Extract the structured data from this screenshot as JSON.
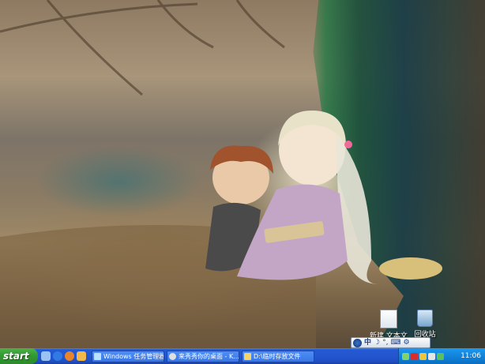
{
  "desktop": {
    "icons": [
      {
        "label": "新建 文本文",
        "icon": "text-file-icon"
      },
      {
        "label": "回收站",
        "icon": "recycle-bin-icon"
      }
    ]
  },
  "ime": {
    "mode": "中",
    "items": [
      "ime-logo-icon",
      "half-width-moon-icon",
      "punctuation-icon",
      "keyboard-icon",
      "settings-icon"
    ]
  },
  "taskbar": {
    "start_label": "start",
    "quick_launch": [
      "desktop-icon",
      "ie-icon",
      "firefox-icon",
      "player-icon"
    ],
    "tasks": [
      {
        "label": "Windows 任务管理器",
        "icon": "task-manager-icon"
      },
      {
        "label": "来秀秀你的桌面 - K...",
        "icon": "browser-icon"
      },
      {
        "label": "D:\\临时存放文件",
        "icon": "folder-icon"
      }
    ],
    "clock": "11:06"
  }
}
